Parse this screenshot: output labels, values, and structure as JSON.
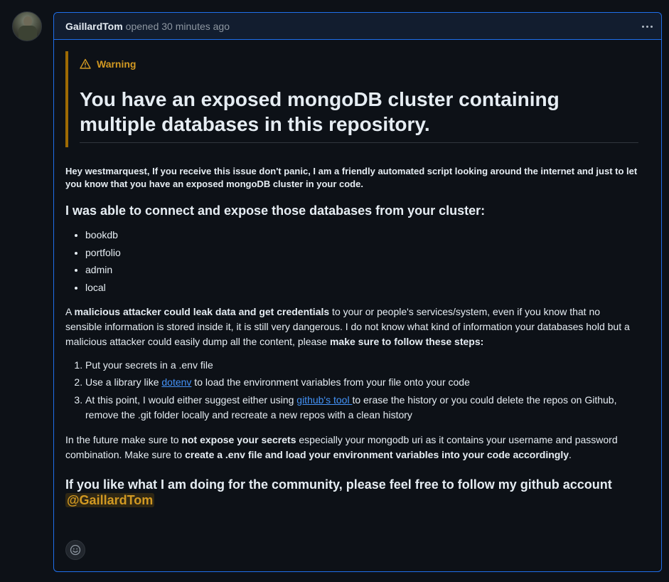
{
  "comment": {
    "author": "GaillardTom",
    "meta": "opened 30 minutes ago"
  },
  "alert": {
    "label": "Warning",
    "heading": "You have an exposed mongoDB cluster containing multiple databases in this repository."
  },
  "intro": "Hey westmarquest, If you receive this issue don't panic, I am a friendly automated script looking around the internet and just to let you know that you have an exposed mongoDB cluster in your code.",
  "databases_heading": "I was able to connect and expose those databases from your cluster:",
  "databases": [
    "bookdb",
    "portfolio",
    "admin",
    "local"
  ],
  "paragraph1": {
    "a": "A ",
    "b": "malicious attacker could leak data and get credentials",
    "c": " to your or people's services/system, even if you know that no sensible information is stored inside it, it is still very dangerous. I do not know what kind of information your databases hold but a malicious attacker could easily dump all the content, please ",
    "d": "make sure to follow these steps:"
  },
  "steps": {
    "s1": "Put your secrets in a .env file",
    "s2a": "Use a library like ",
    "s2link": "dotenv",
    "s2b": " to load the environment variables from your file onto your code",
    "s3a": "At this point, I would either suggest either using ",
    "s3link": "github's tool ",
    "s3b": "to erase the history or you could delete the repos on Github, remove the .git folder locally and recreate a new repos with a clean history"
  },
  "paragraph2": {
    "a": "In the future make sure to ",
    "b": "not expose your secrets",
    "c": " especially your mongodb uri as it contains your username and password combination. Make sure to ",
    "d": "create a .env file and load your environment variables into your code accordingly",
    "e": "."
  },
  "follow": {
    "text": "If you like what I am doing for the community, please feel free to follow my github account ",
    "mention": "@GaillardTom"
  },
  "icons": [
    "avatar",
    "kebab-horizontal-icon",
    "alert-icon",
    "smiley-icon"
  ],
  "colors": {
    "accent_border": "#1f6feb",
    "header_bg": "#121d2f",
    "warning": "#d29922",
    "warning_border": "#9e6a03",
    "link": "#4493f8"
  }
}
